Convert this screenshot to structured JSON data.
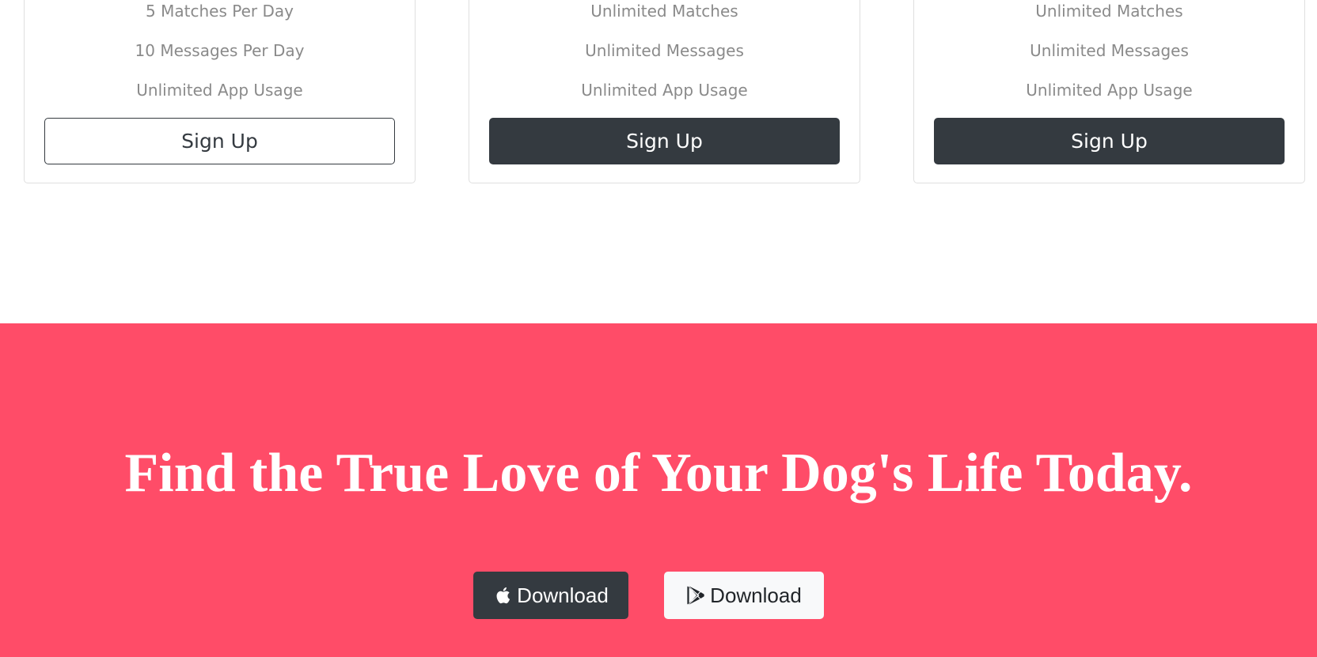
{
  "pricing": {
    "cards": [
      {
        "features": [
          "5 Matches Per Day",
          "10 Messages Per Day",
          "Unlimited App Usage"
        ],
        "button_label": "Sign Up"
      },
      {
        "features": [
          "Unlimited Matches",
          "Unlimited Messages",
          "Unlimited App Usage"
        ],
        "button_label": "Sign Up"
      },
      {
        "features": [
          "Unlimited Matches",
          "Unlimited Messages",
          "Unlimited App Usage"
        ],
        "button_label": "Sign Up"
      }
    ]
  },
  "cta": {
    "title": "Find the True Love of Your Dog's Life Today.",
    "background_color": "#ff4c68",
    "buttons": [
      {
        "label": "Download",
        "icon": "apple-icon"
      },
      {
        "label": "Download",
        "icon": "google-play-icon"
      }
    ]
  }
}
